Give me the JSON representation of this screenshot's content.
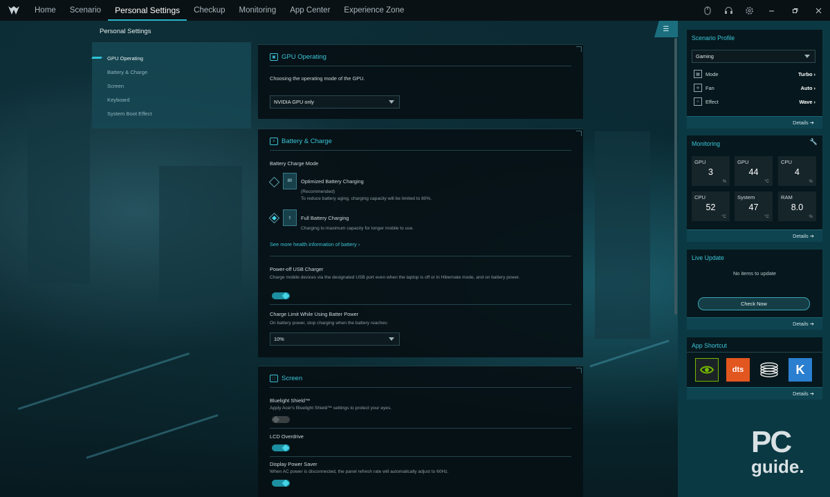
{
  "nav": {
    "items": [
      "Home",
      "Scenario",
      "Personal Settings",
      "Checkup",
      "Monitoring",
      "App Center",
      "Experience Zone"
    ],
    "active_index": 2
  },
  "page": {
    "title": "Personal Settings"
  },
  "left_menu": {
    "items": [
      "GPU Operating",
      "Battery & Charge",
      "Screen",
      "Keyboard",
      "System Boot Effect"
    ],
    "active_index": 0
  },
  "gpu_card": {
    "title": "GPU Operating",
    "description": "Choosing the operating mode of the GPU.",
    "mode_value": "NVIDIA GPU only"
  },
  "battery_card": {
    "title": "Battery & Charge",
    "section_label": "Battery Charge Mode",
    "option1_title": "Optimized Battery Charging",
    "option1_note": "(Recommended)",
    "option1_desc": "To reduce battery aging, charging capacity will be limited to 80%.",
    "option1_icon_text": "80",
    "option2_title": "Full Battery Charging",
    "option2_desc": "Charging to maximum capacity for longer mobile to use.",
    "selected_option": 2,
    "health_link": "See more health information of battery",
    "usb_title": "Power-off USB Charger",
    "usb_desc": "Charge mobile devices via the designated USB port even when the laptop is off or in Hibernate mode, and on battery power.",
    "usb_enabled": true,
    "limit_title": "Charge Limit While Using Batter Power",
    "limit_desc": "On battery power, stop charging when the battery reaches:",
    "limit_value": "10%"
  },
  "screen_card": {
    "title": "Screen",
    "bluelight_title": "Bluelight Shield™",
    "bluelight_desc": "Apply Acer's Bluelight Shield™ settings to protect your eyes.",
    "bluelight_enabled": false,
    "overdrive_title": "LCD Overdrive",
    "overdrive_enabled": true,
    "power_saver_title": "Display Power Saver",
    "power_saver_desc": "When AC power is disconnected, the panel refresh rate will automatically adjust to 60Hz.",
    "power_saver_enabled": true
  },
  "scenario_profile": {
    "title": "Scenario Profile",
    "profile": "Gaming",
    "rows": [
      {
        "label": "Mode",
        "value": "Turbo"
      },
      {
        "label": "Fan",
        "value": "Auto"
      },
      {
        "label": "Effect",
        "value": "Wave"
      }
    ],
    "details": "Details"
  },
  "monitoring": {
    "title": "Monitoring",
    "tiles": [
      {
        "label": "GPU",
        "value": "3",
        "unit": "%"
      },
      {
        "label": "GPU",
        "value": "44",
        "unit": "°C"
      },
      {
        "label": "CPU",
        "value": "4",
        "unit": "%"
      },
      {
        "label": "CPU",
        "value": "52",
        "unit": "°C"
      },
      {
        "label": "System",
        "value": "47",
        "unit": "°C"
      },
      {
        "label": "RAM",
        "value": "8.0",
        "unit": "%"
      }
    ],
    "details": "Details"
  },
  "live_update": {
    "title": "Live Update",
    "status": "No items to update",
    "button": "Check Now",
    "details": "Details"
  },
  "app_shortcut": {
    "title": "App Shortcut",
    "apps": [
      "nvidia-icon",
      "dts-icon",
      "disc-app-icon",
      "killer-icon"
    ],
    "dts_text": "dts",
    "killer_text": "K",
    "details": "Details"
  },
  "watermark": {
    "line1": "PC",
    "line2": "guide."
  },
  "colors": {
    "accent": "#3cc4d8",
    "nav_bg": "#0a1114",
    "panel_bg": "#0b3943"
  }
}
